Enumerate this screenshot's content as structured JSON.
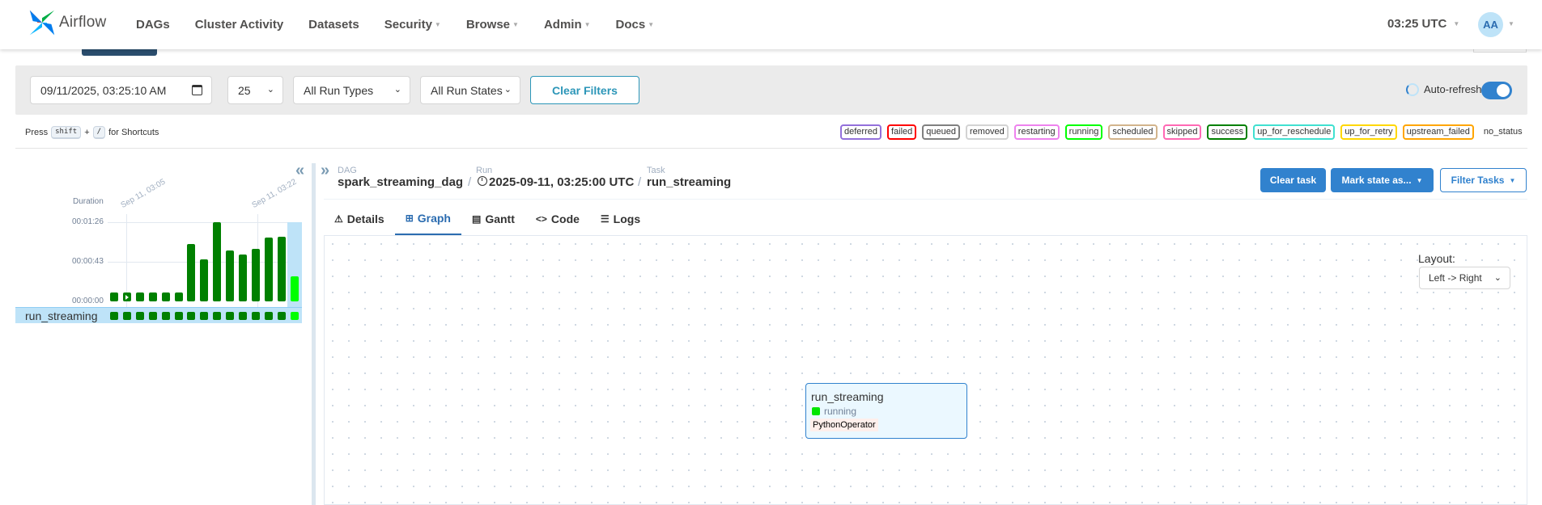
{
  "nav": {
    "brand": "Airflow",
    "items": [
      "DAGs",
      "Cluster Activity",
      "Datasets",
      "Security",
      "Browse",
      "Admin",
      "Docs"
    ],
    "time": "03:25 UTC",
    "user_initials": "AA"
  },
  "filters": {
    "date_value": "09/11/2025, 03:25:10 AM",
    "num_runs": "25",
    "run_type": "All Run Types",
    "run_state": "All Run States",
    "clear_label": "Clear Filters",
    "auto_refresh_label": "Auto-refresh",
    "auto_refresh_on": true
  },
  "shortcuts": {
    "press": "Press",
    "key1": "shift",
    "plus": "+",
    "key2": "/",
    "suffix": "for Shortcuts"
  },
  "legend": [
    {
      "label": "deferred",
      "color": "#9370db"
    },
    {
      "label": "failed",
      "color": "#ff0000"
    },
    {
      "label": "queued",
      "color": "#808080"
    },
    {
      "label": "removed",
      "color": "#d3d3d3"
    },
    {
      "label": "restarting",
      "color": "#ee82ee"
    },
    {
      "label": "running",
      "color": "#00ff00"
    },
    {
      "label": "scheduled",
      "color": "#d2b48c"
    },
    {
      "label": "skipped",
      "color": "#ff69b4"
    },
    {
      "label": "success",
      "color": "#008000"
    },
    {
      "label": "up_for_reschedule",
      "color": "#40e0d0"
    },
    {
      "label": "up_for_retry",
      "color": "#ffd700"
    },
    {
      "label": "upstream_failed",
      "color": "#ffa500"
    },
    {
      "label": "no_status",
      "color": ""
    }
  ],
  "grid": {
    "duration_label": "Duration",
    "y_ticks": [
      "00:01:26",
      "00:00:43",
      "00:00:00"
    ],
    "y_max_seconds": 86,
    "date_labels": [
      "Sep 11, 03:05",
      "Sep 11, 03:22"
    ],
    "task_name": "run_streaming",
    "run_durations_seconds": [
      10,
      10,
      10,
      10,
      10,
      10,
      62,
      46,
      86,
      55,
      51,
      57,
      69,
      70,
      27
    ],
    "run_states": [
      "success",
      "success",
      "success",
      "success",
      "success",
      "success",
      "success",
      "success",
      "success",
      "success",
      "success",
      "success",
      "success",
      "success",
      "running"
    ],
    "colors": {
      "success": "#008000",
      "running": "#00ff00"
    }
  },
  "details": {
    "dag_label": "DAG",
    "dag_id": "spark_streaming_dag",
    "run_label": "Run",
    "run_id": "2025-09-11, 03:25:00 UTC",
    "task_label": "Task",
    "task_id": "run_streaming",
    "buttons": {
      "clear_task": "Clear task",
      "mark_state": "Mark state as...",
      "filter_tasks": "Filter Tasks"
    },
    "tabs": [
      "Details",
      "Graph",
      "Gantt",
      "Code",
      "Logs"
    ],
    "active_tab": "Graph"
  },
  "graph": {
    "layout_label": "Layout:",
    "layout_value": "Left -> Right",
    "node": {
      "task_id": "run_streaming",
      "state": "running",
      "operator": "PythonOperator"
    }
  }
}
